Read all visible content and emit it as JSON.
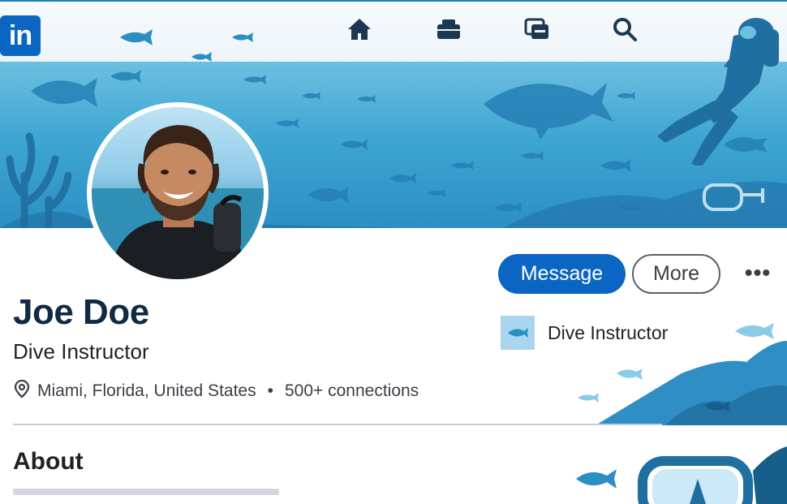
{
  "nav": {
    "logo_text": "in",
    "icons": [
      "home-icon",
      "briefcase-icon",
      "messaging-icon",
      "search-icon"
    ],
    "accent": "#0a66c2"
  },
  "profile": {
    "name": "Joe Doe",
    "headline": "Dive Instructor",
    "location": "Miami, Florida, United States",
    "separator": "•",
    "connections": "500+ connections"
  },
  "actions": {
    "message_label": "Message",
    "more_label": "More",
    "overflow_label": "•••"
  },
  "experience": {
    "company_name": "Dive Instructor"
  },
  "about": {
    "heading": "About"
  },
  "colors": {
    "primary": "#0a66c2",
    "banner_light": "#6cc0e0",
    "banner_dark": "#2b8fc4",
    "name_color": "#102a43"
  }
}
